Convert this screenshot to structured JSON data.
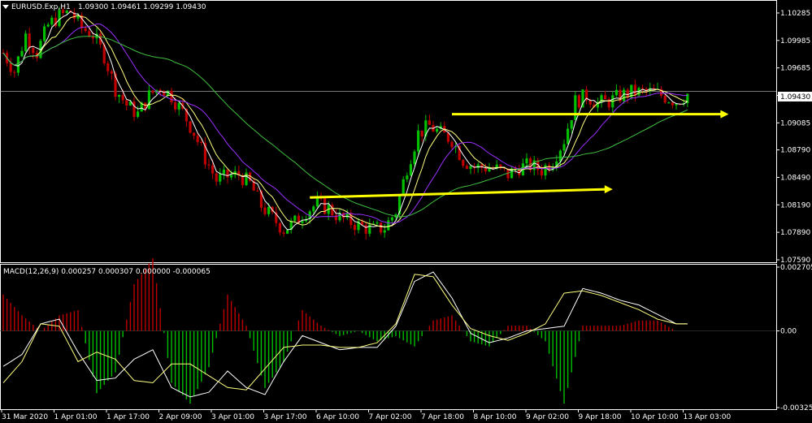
{
  "header": {
    "symbol": "EURUSD.Exp,H1",
    "ohlc": "1.09300 1.09461 1.09299 1.09430"
  },
  "price_label": "1.09430",
  "macd_label": "MACD(12,26,9) 0.000257 0.000307 0.000000 -0.000065",
  "colors": {
    "background": "#000000",
    "bull": "#00c000",
    "bear": "#c00000",
    "ma_fast": "#ffffff",
    "ma_yellow": "#ffff80",
    "ma_violet": "#9b30ff",
    "ma_green": "#40c040",
    "arrow": "#ffff00",
    "grid": "#ffffff"
  },
  "chart_data": [
    {
      "type": "candlestick",
      "title": "EURUSD.Exp,H1",
      "y_ticks": [
        "1.10285",
        "1.09985",
        "1.09685",
        "1.09385",
        "1.09085",
        "1.08790",
        "1.08490",
        "1.08190",
        "1.07890",
        "1.07590"
      ],
      "ylim": [
        1.0759,
        1.104
      ],
      "current_price": 1.0943,
      "x_ticks": [
        "31 Mar 2020",
        "1 Apr 01:00",
        "1 Apr 17:00",
        "2 Apr 09:00",
        "3 Apr 01:00",
        "3 Apr 17:00",
        "6 Apr 10:00",
        "7 Apr 02:00",
        "7 Apr 18:00",
        "8 Apr 10:00",
        "9 Apr 02:00",
        "9 Apr 18:00",
        "10 Apr 10:00",
        "13 Apr 03:00"
      ],
      "close_path": [
        [
          0,
          1.0985
        ],
        [
          3,
          1.0965
        ],
        [
          6,
          1.1005
        ],
        [
          9,
          1.0985
        ],
        [
          12,
          1.1015
        ],
        [
          15,
          1.1025
        ],
        [
          18,
          1.103
        ],
        [
          21,
          1.1012
        ],
        [
          24,
          1.1005
        ],
        [
          27,
          1.0982
        ],
        [
          30,
          1.0946
        ],
        [
          33,
          1.0928
        ],
        [
          36,
          1.0918
        ],
        [
          39,
          1.0938
        ],
        [
          42,
          1.0948
        ],
        [
          45,
          1.0938
        ],
        [
          48,
          1.092
        ],
        [
          51,
          1.0898
        ],
        [
          54,
          1.087
        ],
        [
          57,
          1.0846
        ],
        [
          60,
          1.085
        ],
        [
          63,
          1.0852
        ],
        [
          66,
          1.0842
        ],
        [
          69,
          1.0818
        ],
        [
          72,
          1.0805
        ],
        [
          75,
          1.0792
        ],
        [
          78,
          1.08
        ],
        [
          81,
          1.0812
        ],
        [
          84,
          1.082
        ],
        [
          87,
          1.0815
        ],
        [
          90,
          1.0805
        ],
        [
          93,
          1.08
        ],
        [
          96,
          1.0795
        ],
        [
          99,
          1.0792
        ],
        [
          102,
          1.0794
        ],
        [
          105,
          1.0812
        ],
        [
          108,
          1.086
        ],
        [
          111,
          1.0897
        ],
        [
          114,
          1.0905
        ],
        [
          117,
          1.0897
        ],
        [
          120,
          1.089
        ],
        [
          123,
          1.0868
        ],
        [
          126,
          1.086
        ],
        [
          129,
          1.086
        ],
        [
          132,
          1.0858
        ],
        [
          135,
          1.0852
        ],
        [
          138,
          1.086
        ],
        [
          141,
          1.0862
        ],
        [
          144,
          1.0857
        ],
        [
          147,
          1.0868
        ],
        [
          150,
          1.089
        ],
        [
          153,
          1.0932
        ],
        [
          156,
          1.0938
        ],
        [
          159,
          1.093
        ],
        [
          162,
          1.0932
        ],
        [
          165,
          1.0938
        ],
        [
          168,
          1.0942
        ],
        [
          171,
          1.0942
        ],
        [
          174,
          1.0942
        ],
        [
          177,
          1.0937
        ],
        [
          180,
          1.0932
        ],
        [
          183,
          1.094
        ]
      ],
      "horizontal_line": 1.0943,
      "arrows": [
        {
          "from": [
            120,
            1.0918
          ],
          "to": [
            194,
            1.0918
          ]
        },
        {
          "from": [
            82,
            1.0827
          ],
          "to": [
            163,
            1.0836
          ]
        }
      ]
    },
    {
      "type": "histogram+line",
      "title": "MACD(12,26,9)",
      "series": [
        {
          "name": "MACD",
          "value": 0.000257
        },
        {
          "name": "Signal",
          "value": 0.000307
        }
      ],
      "y_ticks": [
        "0.002705",
        "0.00",
        "-0.00325"
      ],
      "ylim": [
        -0.00325,
        0.002705
      ],
      "macd_path": [
        [
          0,
          -0.0015
        ],
        [
          5,
          -0.001
        ],
        [
          10,
          0.0003
        ],
        [
          15,
          0.0005
        ],
        [
          20,
          -0.0009
        ],
        [
          25,
          -0.0021
        ],
        [
          30,
          -0.002
        ],
        [
          35,
          -0.0012
        ],
        [
          40,
          -0.0008
        ],
        [
          45,
          -0.0024
        ],
        [
          50,
          -0.0028
        ],
        [
          55,
          -0.0026
        ],
        [
          60,
          -0.0017
        ],
        [
          65,
          -0.0024
        ],
        [
          70,
          -0.0027
        ],
        [
          75,
          -0.0013
        ],
        [
          80,
          -0.0002
        ],
        [
          85,
          -0.0005
        ],
        [
          90,
          -0.0008
        ],
        [
          95,
          -0.0007
        ],
        [
          100,
          -0.0007
        ],
        [
          105,
          0.0002
        ],
        [
          110,
          0.0021
        ],
        [
          115,
          0.0025
        ],
        [
          120,
          0.0014
        ],
        [
          125,
          -0.0001
        ],
        [
          130,
          -0.0005
        ],
        [
          135,
          -0.0003
        ],
        [
          140,
          0.0
        ],
        [
          145,
          0.0001
        ],
        [
          150,
          0.0002
        ],
        [
          155,
          0.0018
        ],
        [
          160,
          0.0016
        ],
        [
          165,
          0.0013
        ],
        [
          170,
          0.0011
        ],
        [
          175,
          0.0007
        ],
        [
          180,
          0.0003
        ],
        [
          183,
          0.0003
        ]
      ],
      "signal_path": [
        [
          0,
          -0.0022
        ],
        [
          5,
          -0.0013
        ],
        [
          10,
          0.0003
        ],
        [
          15,
          0.0002
        ],
        [
          20,
          -0.0013
        ],
        [
          25,
          -0.0009
        ],
        [
          30,
          -0.0012
        ],
        [
          35,
          -0.0021
        ],
        [
          40,
          -0.0022
        ],
        [
          45,
          -0.0014
        ],
        [
          50,
          -0.0014
        ],
        [
          55,
          -0.0019
        ],
        [
          60,
          -0.0024
        ],
        [
          65,
          -0.0025
        ],
        [
          70,
          -0.0016
        ],
        [
          75,
          -0.0007
        ],
        [
          80,
          -0.0006
        ],
        [
          85,
          -0.0006
        ],
        [
          90,
          -0.0007
        ],
        [
          95,
          -0.0007
        ],
        [
          100,
          -0.0005
        ],
        [
          105,
          0.0003
        ],
        [
          110,
          0.0024
        ],
        [
          115,
          0.0023
        ],
        [
          120,
          0.0011
        ],
        [
          125,
          0.0001
        ],
        [
          130,
          -0.0002
        ],
        [
          135,
          -0.0004
        ],
        [
          140,
          -0.0001
        ],
        [
          145,
          0.0003
        ],
        [
          150,
          0.0016
        ],
        [
          155,
          0.0017
        ],
        [
          160,
          0.0015
        ],
        [
          165,
          0.0012
        ],
        [
          170,
          0.0009
        ],
        [
          175,
          0.0005
        ],
        [
          180,
          0.0003
        ],
        [
          183,
          0.0003
        ]
      ]
    }
  ]
}
